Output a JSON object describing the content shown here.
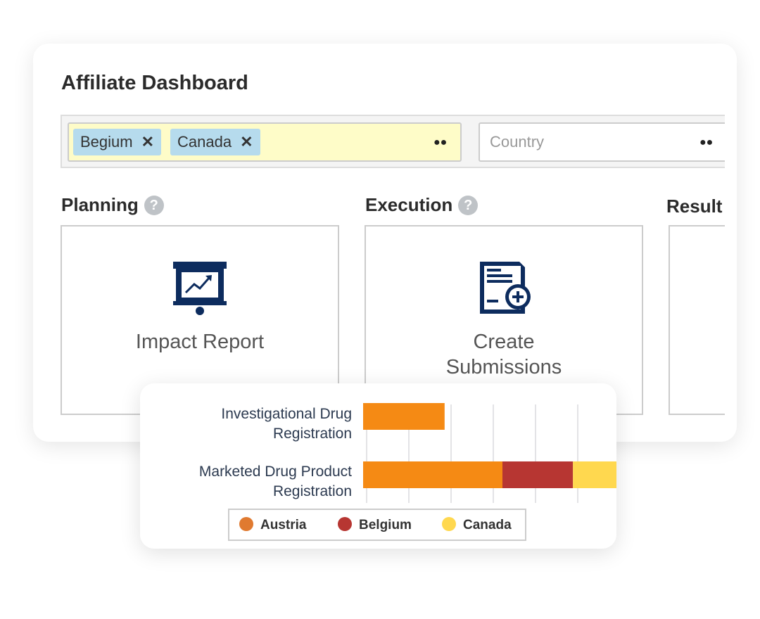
{
  "title": "Affiliate Dashboard",
  "filters": {
    "chips": [
      {
        "label": "Begium",
        "remove": "✕"
      },
      {
        "label": "Canada",
        "remove": "✕"
      }
    ],
    "country_placeholder": "Country",
    "search_icon": "binoculars-icon"
  },
  "sections": [
    {
      "title": "Planning",
      "help": "?",
      "tile": "Impact Report",
      "icon": "presentation-chart-icon"
    },
    {
      "title": "Execution",
      "help": "?",
      "tile_lines": [
        "Create",
        "Submissions"
      ],
      "icon": "document-add-icon"
    },
    {
      "title": "Result"
    }
  ],
  "chart_data": {
    "type": "bar",
    "orientation": "horizontal",
    "stacked": true,
    "categories": [
      "Investigational Drug Registration",
      "Marketed Drug Product Registration"
    ],
    "category_lines": [
      [
        "Investigational Drug",
        "Registration"
      ],
      [
        "Marketed Drug Product",
        "Registration"
      ]
    ],
    "series": [
      {
        "name": "Austria",
        "color": "#f58a14",
        "values": [
          1.93,
          3.3
        ]
      },
      {
        "name": "Belgium",
        "color": "#b73632",
        "values": [
          0,
          1.67
        ]
      },
      {
        "name": "Canada",
        "color": "#ffd84f",
        "values": [
          0,
          1.05
        ]
      }
    ],
    "legend_colors": [
      "#e07a30",
      "#b73632",
      "#ffd84f"
    ],
    "xlim": [
      0,
      6
    ],
    "grid": true,
    "legend": "bottom"
  }
}
